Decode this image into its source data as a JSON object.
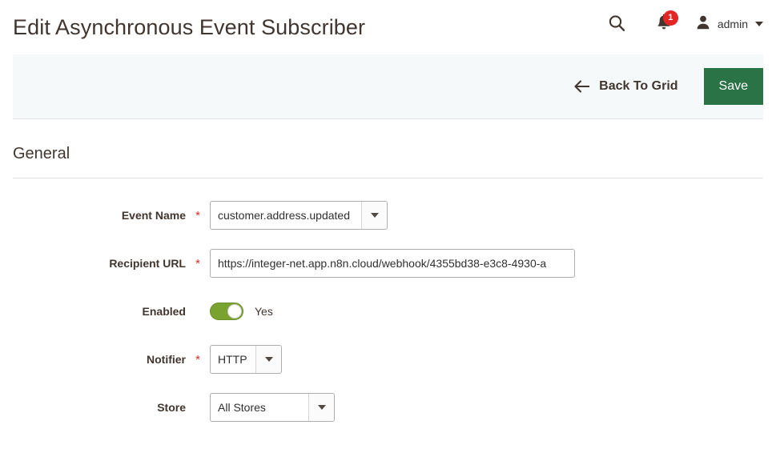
{
  "header": {
    "title": "Edit Asynchronous Event Subscriber",
    "search_icon": "search-icon",
    "notifications_icon": "bell-icon",
    "notifications_count": "1",
    "user_icon": "user-avatar-icon",
    "user_name": "admin",
    "user_caret_icon": "chevron-down-icon"
  },
  "actions": {
    "back_icon": "arrow-left-icon",
    "back_label": "Back To Grid",
    "save_label": "Save",
    "save_color": "#2a7346"
  },
  "section": {
    "title": "General"
  },
  "form": {
    "fields": [
      {
        "label": "Event Name",
        "required": "*",
        "type": "select",
        "value": "customer.address.updated"
      },
      {
        "label": "Recipient URL",
        "required": "*",
        "type": "text",
        "value": "https://integer-net.app.n8n.cloud/webhook/4355bd38-e3c8-4930-a",
        "placeholder": ""
      },
      {
        "label": "Enabled",
        "required": "",
        "type": "toggle",
        "value": "Yes",
        "toggle_color": "#79a22e"
      },
      {
        "label": "Notifier",
        "required": "*",
        "type": "select",
        "value": "HTTP"
      },
      {
        "label": "Store",
        "required": "",
        "type": "select",
        "value": "All Stores"
      }
    ]
  }
}
